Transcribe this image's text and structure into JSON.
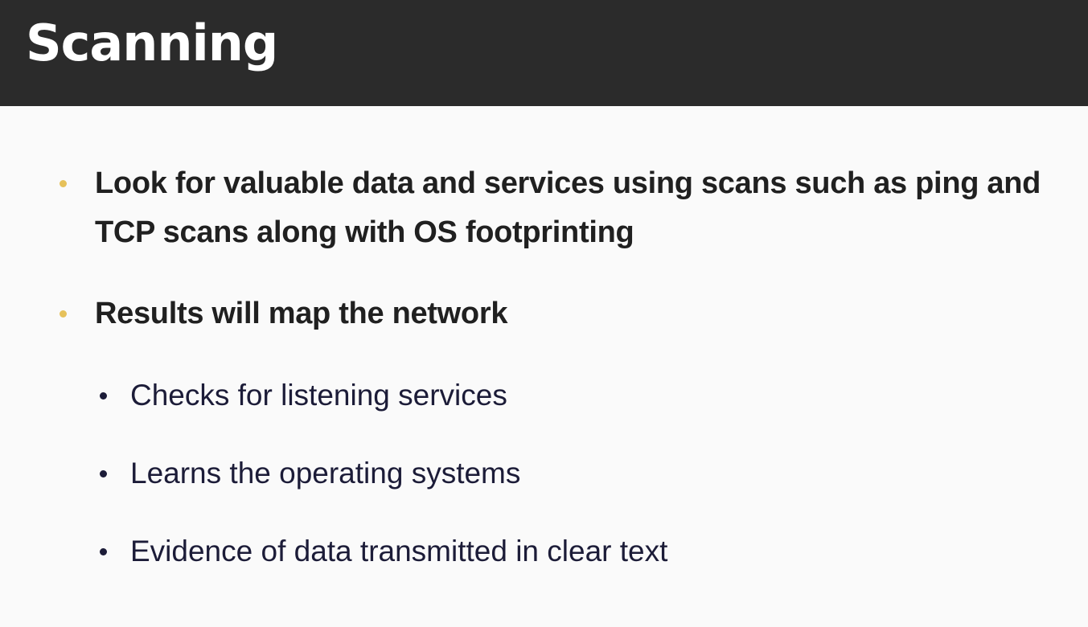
{
  "slide": {
    "title": "Scanning",
    "bullets": [
      {
        "text": "Look for valuable data and services using scans such as ping and TCP scans along with OS footprinting"
      },
      {
        "text": "Results will map the network"
      }
    ],
    "sub_bullets": [
      {
        "text": "Checks for listening services"
      },
      {
        "text": "Learns the operating systems"
      },
      {
        "text": "Evidence of data transmitted in clear text"
      }
    ]
  },
  "colors": {
    "title_bar": "#2b2b2b",
    "title_text": "#ffffff",
    "bullet_accent": "#e6c15a",
    "body_text": "#202020",
    "sub_text": "#1c1c38",
    "background": "#fafafa"
  }
}
